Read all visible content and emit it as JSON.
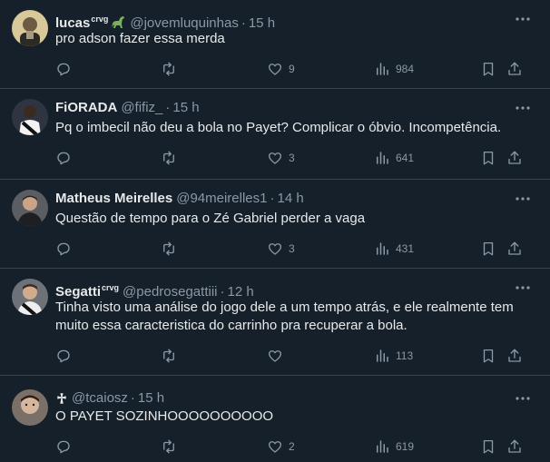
{
  "tweets": [
    {
      "name": "lucas",
      "badge": "crvg",
      "emoji": "sauropod-emoji",
      "handle": "@jovemluquinhas",
      "sep": "·",
      "time": "15 h",
      "text": "pro adson fazer essa merda",
      "likes": "9",
      "views": "984"
    },
    {
      "name": "FiORADA",
      "badge": "",
      "emoji": "",
      "handle": "@fifiz_",
      "sep": "·",
      "time": "15 h",
      "text": "Pq o imbecil não deu a bola no Payet? Complicar o óbvio. Incompetência.",
      "likes": "3",
      "views": "641"
    },
    {
      "name": "Matheus Meirelles",
      "badge": "",
      "emoji": "",
      "handle": "@94meirelles1",
      "sep": "·",
      "time": "14 h",
      "text": "Questão de tempo para o Zé Gabriel perder a vaga",
      "likes": "3",
      "views": "431"
    },
    {
      "name": "Segatti",
      "badge": "crvg",
      "emoji": "",
      "handle": "@pedrosegattiii",
      "sep": "·",
      "time": "12 h",
      "text": "Tinha visto uma análise do jogo dele a um tempo atrás, e ele realmente tem muito essa caracteristica do carrinho pra recuperar a bola.",
      "likes": "",
      "views": "113"
    },
    {
      "name": "",
      "badge": "",
      "emoji": "vasco-cross-emoji",
      "handle": "@tcaiosz",
      "sep": "·",
      "time": "15 h",
      "text": "O PAYET SOZINHOOOOOOOOOO",
      "likes": "2",
      "views": "619"
    }
  ],
  "colors": {
    "background": "#15202b",
    "text": "#e7e9ea",
    "muted": "#8b98a5",
    "divider": "#38444d"
  }
}
